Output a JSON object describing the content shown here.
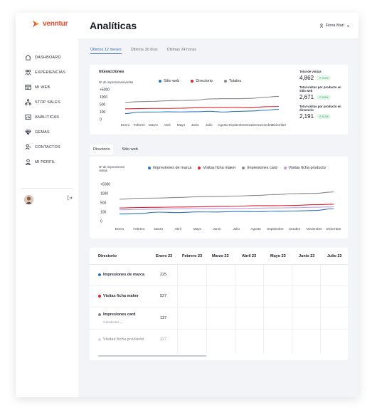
{
  "brand": {
    "name": "venntur",
    "color": "#e8482b"
  },
  "sidebar": {
    "items": [
      {
        "label": "DASHBOARD",
        "icon": "home-icon"
      },
      {
        "label": "EXPERIENCIAS",
        "icon": "people-icon"
      },
      {
        "label": "MI WEB",
        "icon": "web-icon"
      },
      {
        "label": "STOP SALES",
        "icon": "network-icon"
      },
      {
        "label": "ANALÍTICAS",
        "icon": "analytics-icon"
      },
      {
        "label": "GEMAS",
        "icon": "gem-icon"
      },
      {
        "label": "CONTACTOS",
        "icon": "contacts-icon"
      },
      {
        "label": "MI PERFIL",
        "icon": "user-icon"
      }
    ]
  },
  "header": {
    "title": "Analíticas",
    "user_name": "Fiona Marí"
  },
  "time_tabs": [
    "Últimos 12 meses",
    "Últimos 30 días",
    "Últimas 24 horas"
  ],
  "interactions_card": {
    "title": "Interacciones",
    "y_unit": "Nº de impresiones/visitas",
    "legend": [
      {
        "name": "Sitio web",
        "color": "#2f74c0"
      },
      {
        "name": "Directorio",
        "color": "#e0202e"
      },
      {
        "name": "Totales",
        "color": "#8a8a8a"
      }
    ]
  },
  "stats": [
    {
      "label": "Total de visitas",
      "value": "4,862",
      "delta": "↗ 9.2%"
    },
    {
      "label": "Total visitas por producto en sitio web",
      "value": "2,671",
      "delta": "↗ 6.6%"
    },
    {
      "label": "Total visitas por producto en directorio",
      "value": "2,191",
      "delta": "↗ 8.1%"
    }
  ],
  "section_tabs": [
    "Directorio",
    "Sitio web"
  ],
  "directory_card": {
    "y_unit_line1": "Nº de impresiones/",
    "y_unit_line2": "visitas",
    "legend": [
      {
        "name": "Impresiones de marca",
        "color": "#2f74c0"
      },
      {
        "name": "Visitas ficha maker",
        "color": "#e0202e"
      },
      {
        "name": "Impresiones card",
        "color": "#8a8a8a"
      },
      {
        "name": "Visitas ficha producto",
        "color": "#c39be0"
      }
    ]
  },
  "table": {
    "headers": [
      "Directorio",
      "Enero 23",
      "Febrero 23",
      "Marzo 23",
      "Abril 23",
      "Mayo 23",
      "Junio 23",
      "Julio 23"
    ],
    "rows": [
      {
        "label": "Impresiones de marca",
        "value": "225",
        "color": "#2f74c0"
      },
      {
        "label": "Visitas ficha maker",
        "value": "527",
        "color": "#e0202e"
      },
      {
        "label": "Impresiones card",
        "value": "137",
        "color": "#8a8a8a",
        "sub": "3 productos  ⌄"
      },
      {
        "label": "Visitas ficha producto",
        "value": "227",
        "color": "#c39be0"
      }
    ]
  },
  "chart_data": [
    {
      "type": "line",
      "title": "Interacciones",
      "ylabel": "Nº de impresiones/visitas",
      "x": [
        "Enero",
        "Febrero",
        "Marzo",
        "Abril",
        "Mayo",
        "Junio",
        "Julio",
        "Agosto",
        "Septiembre",
        "Octubre",
        "Noviembre",
        "Diciembre"
      ],
      "y_ticks": [
        "+5000",
        "1000",
        "500",
        "100",
        "0"
      ],
      "ylim": [
        0,
        5000
      ],
      "series": [
        {
          "name": "Sitio web",
          "color": "#2f74c0",
          "values": [
            80,
            100,
            105,
            115,
            110,
            120,
            145,
            105,
            140,
            160,
            200,
            250
          ]
        },
        {
          "name": "Directorio",
          "color": "#e0202e",
          "values": [
            280,
            290,
            300,
            300,
            310,
            330,
            340,
            350,
            350,
            330,
            390,
            400
          ]
        },
        {
          "name": "Totales",
          "color": "#8a8a8a",
          "values": [
            650,
            700,
            720,
            760,
            780,
            800,
            880,
            900,
            900,
            920,
            1000,
            1400
          ]
        }
      ]
    },
    {
      "type": "line",
      "ylabel": "Nº de impresiones/visitas",
      "x": [
        "Enero",
        "Febrero",
        "Marzo",
        "Abril",
        "Mayo",
        "Junio",
        "Julio",
        "Agosto",
        "Septiembre",
        "Octubre",
        "Noviembre",
        "Diciembre"
      ],
      "y_ticks": [
        "+5000",
        "1000",
        "500",
        "100",
        "0"
      ],
      "ylim": [
        0,
        5000
      ],
      "series": [
        {
          "name": "Impresiones de marca",
          "color": "#2f74c0",
          "values": [
            80,
            85,
            100,
            95,
            110,
            105,
            130,
            120,
            140,
            150,
            170,
            250
          ]
        },
        {
          "name": "Visitas ficha maker",
          "color": "#e0202e",
          "values": [
            280,
            300,
            310,
            320,
            330,
            345,
            350,
            380,
            380,
            390,
            420,
            440
          ]
        },
        {
          "name": "Impresiones card",
          "color": "#8a8a8a",
          "values": [
            700,
            750,
            760,
            790,
            830,
            850,
            870,
            900,
            950,
            1000,
            1100,
            1700
          ]
        },
        {
          "name": "Visitas ficha producto",
          "color": "#c39be0",
          "values": [
            200,
            220,
            230,
            240,
            250,
            260,
            260,
            270,
            280,
            290,
            310,
            330
          ]
        }
      ]
    }
  ]
}
